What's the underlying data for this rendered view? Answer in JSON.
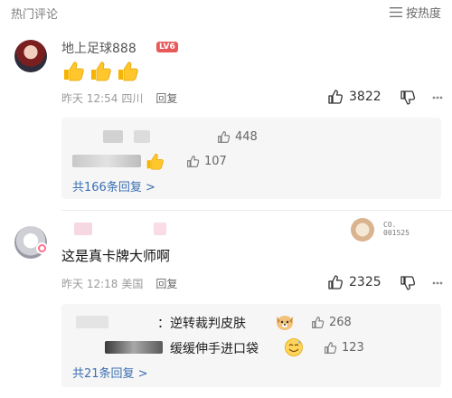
{
  "header": {
    "title": "热门评论",
    "sort_label": "按热度"
  },
  "comments": [
    {
      "username": "地上足球888",
      "level": "LV6",
      "time": "昨天 12:54",
      "location": "四川",
      "reply_label": "回复",
      "likes": "3822",
      "replies": [
        {
          "text": "",
          "likes": "448"
        },
        {
          "text": "",
          "likes": "107"
        }
      ],
      "total_replies": "共166条回复 >"
    },
    {
      "username": "",
      "content": "这是真卡牌大师啊",
      "time": "昨天 12:18",
      "location": "美国",
      "reply_label": "回复",
      "likes": "2325",
      "decor_text_line1": "CO.",
      "decor_text_line2": "001525",
      "replies": [
        {
          "text": "：逆转裁判皮肤",
          "likes": "268"
        },
        {
          "text": "缓缓伸手进口袋",
          "likes": "123"
        }
      ],
      "total_replies": "共21条回复 >"
    }
  ]
}
